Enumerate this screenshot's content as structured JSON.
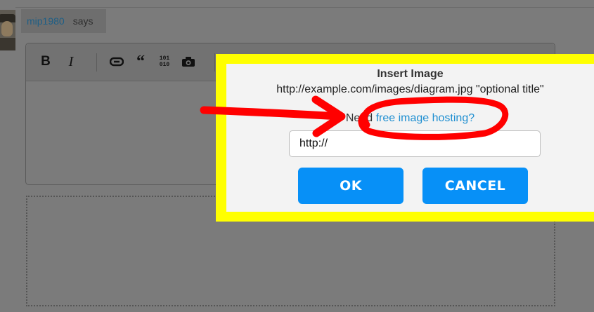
{
  "post": {
    "username": "mip1980",
    "says": "says"
  },
  "toolbar": {
    "bold": "B",
    "italic": "I",
    "quote": "“",
    "code_top": "101",
    "code_bottom": "010"
  },
  "dialog": {
    "title": "Insert Image",
    "example": "http://example.com/images/diagram.jpg \"optional title\"",
    "help_prefix": "Need ",
    "help_link": "free image hosting?",
    "url_value": "http://",
    "ok_label": "OK",
    "cancel_label": "CANCEL"
  },
  "colors": {
    "highlight_frame": "#ffff00",
    "annotation": "#ff0000",
    "button": "#0790f7",
    "link": "#1f8fd1"
  },
  "annotation": {
    "arrow": "red-arrow",
    "circle": "red-circle-around-link"
  }
}
